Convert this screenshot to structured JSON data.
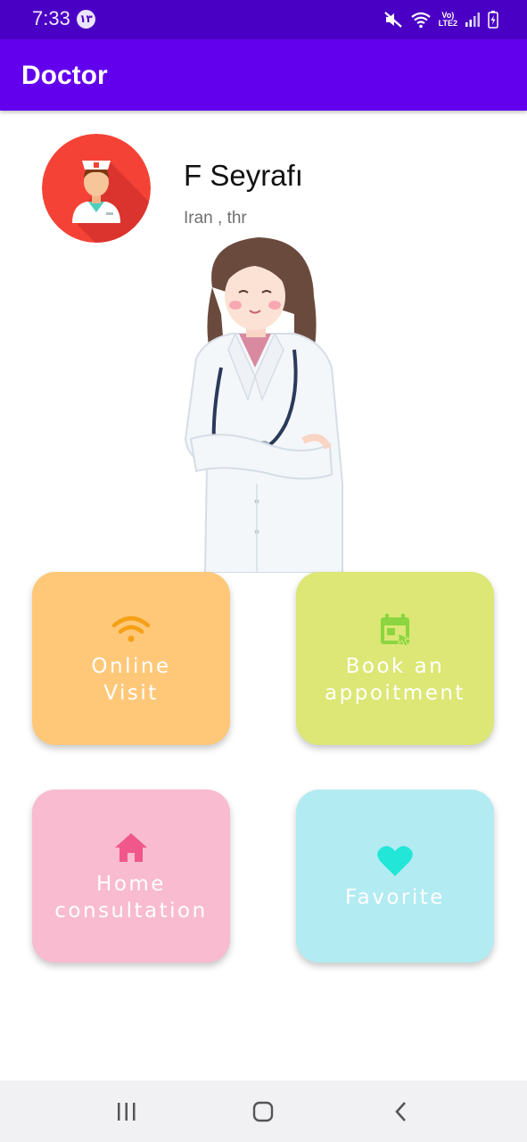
{
  "status_bar": {
    "time": "7:33",
    "badge": "١٣",
    "network": "Vo) LTE2"
  },
  "app_bar": {
    "title": "Doctor"
  },
  "profile": {
    "name": "F Seyrafı",
    "location": "Iran , thr",
    "avatar_icon": "nurse-avatar-icon"
  },
  "cards": [
    {
      "label": "Online\nVisit",
      "icon": "wifi-icon",
      "icon_color": "#f6a015",
      "bg": "#ffc879"
    },
    {
      "label": "Book an\nappoitment",
      "icon": "calendar-icon",
      "icon_color": "#8bd640",
      "bg": "#dce775"
    },
    {
      "label": "Home\nconsultation",
      "icon": "home-icon",
      "icon_color": "#f0578b",
      "bg": "#f8bbd0"
    },
    {
      "label": "Favorite",
      "icon": "heart-icon",
      "icon_color": "#21e6d8",
      "bg": "#b2ebf2"
    }
  ],
  "colors": {
    "status_bar": "#4a00c4",
    "app_bar": "#6200ee"
  }
}
